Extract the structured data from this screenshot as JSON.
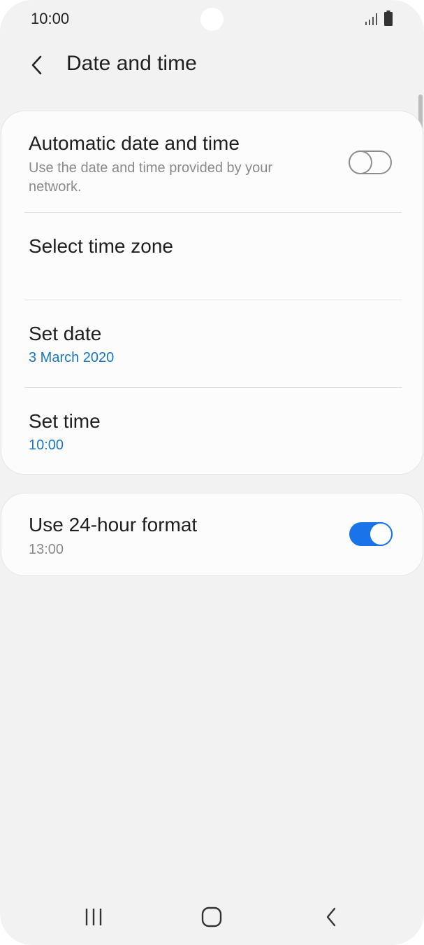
{
  "status_bar": {
    "time": "10:00",
    "icons": [
      "signal-icon",
      "battery-icon"
    ]
  },
  "header": {
    "title": "Date and time",
    "back_icon": "chevron-left-icon"
  },
  "settings": {
    "automatic": {
      "title": "Automatic date and time",
      "subtitle": "Use the date and time provided by your network.",
      "enabled": false
    },
    "time_zone": {
      "title": "Select time zone"
    },
    "set_date": {
      "title": "Set date",
      "value": "3 March 2020"
    },
    "set_time": {
      "title": "Set time",
      "value": "10:00"
    },
    "format_24h": {
      "title": "Use 24-hour format",
      "example": "13:00",
      "enabled": true
    }
  },
  "colors": {
    "accent": "#1a73e8",
    "link_value": "#1976c9",
    "background": "#f2f2f2",
    "card": "#fcfcfc"
  },
  "nav_bar": [
    "recents-icon",
    "home-icon",
    "back-icon"
  ]
}
